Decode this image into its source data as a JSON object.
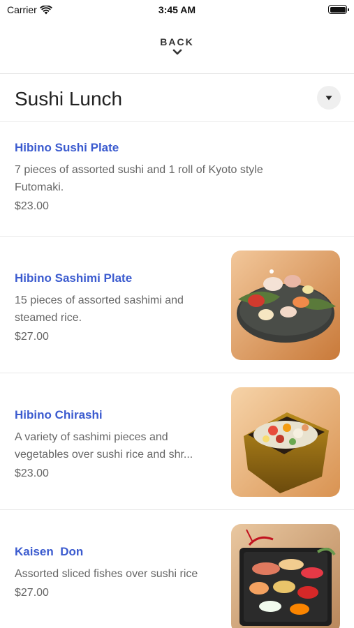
{
  "status_bar": {
    "carrier": "Carrier",
    "time": "3:45 AM"
  },
  "nav": {
    "back_label": "BACK"
  },
  "section": {
    "title": "Sushi Lunch"
  },
  "menu_items": [
    {
      "name": "Hibino Sushi Plate",
      "description": "7 pieces of assorted sushi and 1 roll of Kyoto style Futomaki.",
      "price": "$23.00"
    },
    {
      "name": "Hibino Sashimi Plate",
      "description": "15 pieces of assorted sashimi and steamed rice.",
      "price": "$27.00",
      "image": "sashimi-plate-photo"
    },
    {
      "name": "Hibino Chirashi",
      "description": "A variety of sashimi pieces and vegetables over sushi rice and shr...",
      "price": "$23.00",
      "image": "chirashi-box-photo"
    },
    {
      "name": "Kaisen  Don",
      "description": "Assorted sliced fishes over sushi rice",
      "price": "$27.00",
      "image": "kaisen-don-photo"
    }
  ],
  "colors": {
    "item_name": "#3b5bcf",
    "secondary_text": "#666666"
  }
}
